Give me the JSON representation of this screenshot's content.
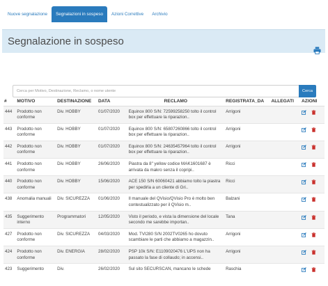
{
  "tabs": [
    {
      "label": "Nuove segnalazione",
      "active": false
    },
    {
      "label": "Segnalazioni in sospeso",
      "active": true
    },
    {
      "label": "Azioni Correttive",
      "active": false
    },
    {
      "label": "Archivio",
      "active": false
    }
  ],
  "panel": {
    "title": "Segnalazione in sospeso"
  },
  "search": {
    "placeholder": "Cerca per Motivo, Destinazione, Reclamo, o nome utente",
    "button_label": "Cerca"
  },
  "icons": {
    "print": "print-icon",
    "edit": "edit-icon",
    "delete": "trash-icon"
  },
  "colors": {
    "accent": "#2a7bbd",
    "panel_header": "#daeaf5",
    "delete": "#c9302c"
  },
  "table": {
    "columns": [
      "#",
      "MOTIVO",
      "DESTINAZIONE",
      "DATA",
      "RECLAMO",
      "REGISTRATA_DA",
      "ALLEGATI",
      "AZIONI"
    ],
    "rows": [
      {
        "id": "444",
        "motivo": "Prodotto non conforme",
        "destinazione": "Div. HOBBY",
        "data": "01/07/2020",
        "reclamo": "Equinox 800 S/N: 72599258250 tolto il control box per effettuare la riparazion..",
        "registrata_da": "Arrigoni",
        "allegati": ""
      },
      {
        "id": "443",
        "motivo": "Prodotto non conforme",
        "destinazione": "Div. HOBBY",
        "data": "01/07/2020",
        "reclamo": "Equinox 800 S/N: 65807260866 tolto il control box per effettuare la riparazion..",
        "registrata_da": "Arrigoni",
        "allegati": ""
      },
      {
        "id": "442",
        "motivo": "Prodotto non conforme",
        "destinazione": "Div. HOBBY",
        "data": "01/07/2020",
        "reclamo": "Equinox 800 S/N: 24635457964 tolto il control box per effettuare la riparazion..",
        "registrata_da": "Arrigoni",
        "allegati": ""
      },
      {
        "id": "441",
        "motivo": "Prodotto non conforme",
        "destinazione": "Div. HOBBY",
        "data": "26/06/2020",
        "reclamo": "Piastra da 8\" yellow codice MAK1601687 è arrivata da makro senza il copripi..",
        "registrata_da": "Ricci",
        "allegati": ""
      },
      {
        "id": "440",
        "motivo": "Prodotto non conforme",
        "destinazione": "Div. HOBBY",
        "data": "15/06/2020",
        "reclamo": "ACE 150 S/N 60060421 abbiamo tolto la piastra per spedirla a un cliente di Gri..",
        "registrata_da": "Ricci",
        "allegati": ""
      },
      {
        "id": "438",
        "motivo": "Anomalia manuali",
        "destinazione": "Div. SICUREZZA",
        "data": "01/06/2020",
        "reclamo": "Il manuale del QVisio/QVisio Pro è molto ben contestualizzato per il QVisio m..",
        "registrata_da": "Balzani",
        "allegati": ""
      },
      {
        "id": "435",
        "motivo": "Suggerimento interno",
        "destinazione": "Programmatori",
        "data": "12/05/2020",
        "reclamo": "Visto il periodo, e vista la dimensione del locale secondo me sarebbe importan..",
        "registrata_da": "Tana",
        "allegati": ""
      },
      {
        "id": "427",
        "motivo": "Prodotto non conforme",
        "destinazione": "Div. SICUREZZA",
        "data": "04/03/2020",
        "reclamo": "Mod. TVI280 S/N 2002TV0265 ho dovuto scambiare le parti che abbiamo a magazzin..",
        "registrata_da": "Arrigoni",
        "allegati": ""
      },
      {
        "id": "424",
        "motivo": "Prodotto non conforme",
        "destinazione": "Div. ENERGIA",
        "data": "28/02/2020",
        "reclamo": "PSP 10k S/N: E1109020476 L'UPS non ha passato la fase di collaudo; in accensi..",
        "registrata_da": "Arrigoni",
        "allegati": ""
      },
      {
        "id": "423",
        "motivo": "Suggerimento",
        "destinazione": "Div.",
        "data": "26/02/2020",
        "reclamo": "Sul sito SECURSCAN, mancano le schede",
        "registrata_da": "Raschia",
        "allegati": ""
      }
    ]
  }
}
